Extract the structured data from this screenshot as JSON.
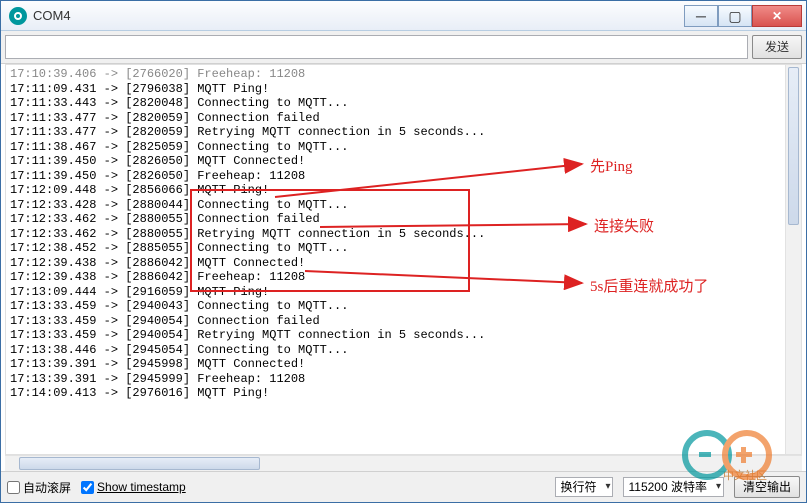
{
  "window": {
    "title": "COM4"
  },
  "toolbar": {
    "send_label": "发送"
  },
  "log": [
    "17:10:39.406 -> [2766020] Freeheap: 11208",
    "17:11:09.431 -> [2796038] MQTT Ping!",
    "17:11:33.443 -> [2820048] Connecting to MQTT...",
    "17:11:33.477 -> [2820059] Connection failed",
    "17:11:33.477 -> [2820059] Retrying MQTT connection in 5 seconds...",
    "17:11:38.467 -> [2825059] Connecting to MQTT...",
    "17:11:39.450 -> [2826050] MQTT Connected!",
    "17:11:39.450 -> [2826050] Freeheap: 11208",
    "17:12:09.448 -> [2856066] MQTT Ping!",
    "17:12:33.428 -> [2880044] Connecting to MQTT...",
    "17:12:33.462 -> [2880055] Connection failed",
    "17:12:33.462 -> [2880055] Retrying MQTT connection in 5 seconds...",
    "17:12:38.452 -> [2885055] Connecting to MQTT...",
    "17:12:39.438 -> [2886042] MQTT Connected!",
    "17:12:39.438 -> [2886042] Freeheap: 11208",
    "17:13:09.444 -> [2916059] MQTT Ping!",
    "17:13:33.459 -> [2940043] Connecting to MQTT...",
    "17:13:33.459 -> [2940054] Connection failed",
    "17:13:33.459 -> [2940054] Retrying MQTT connection in 5 seconds...",
    "17:13:38.446 -> [2945054] Connecting to MQTT...",
    "17:13:39.391 -> [2945998] MQTT Connected!",
    "17:13:39.391 -> [2945999] Freeheap: 11208",
    "17:14:09.413 -> [2976016] MQTT Ping!"
  ],
  "bottom": {
    "autoscroll_label": "自动滚屏",
    "showts_label": "Show timestamp",
    "line_ending_sel": "换行符",
    "baud_sel": "115200 波特率",
    "clear_label": "清空输出"
  },
  "annotations": {
    "a1": "先Ping",
    "a2": "连接失败",
    "a3": "5s后重连就成功了"
  },
  "watermark": {
    "suffix_text": "中文社区"
  }
}
